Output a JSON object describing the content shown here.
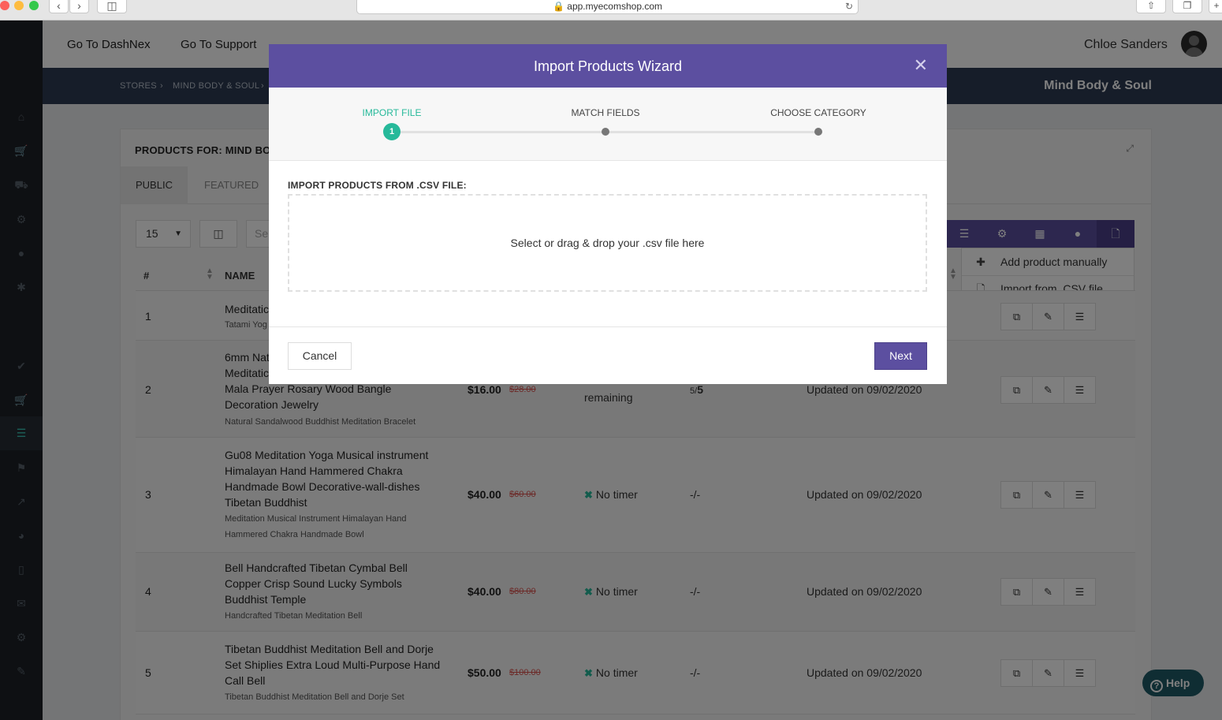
{
  "browser": {
    "url": "app.myecomshop.com"
  },
  "topbar": {
    "links": [
      "Go To DashNex",
      "Go To Support"
    ],
    "user_name": "Chloe Sanders"
  },
  "breadcrumb": {
    "items": [
      "STORES",
      "MIND BODY & SOUL"
    ],
    "store_title": "Mind Body & Soul"
  },
  "panel": {
    "title": "PRODUCTS FOR: MIND BO",
    "tabs": [
      "PUBLIC",
      "FEATURED"
    ],
    "page_size": "15",
    "search_placeholder": "Se"
  },
  "add_menu": {
    "items": [
      {
        "label": "Add product manually",
        "icon": "plus-icon"
      },
      {
        "label": "Import from .CSV file",
        "icon": "csv-file-icon"
      }
    ]
  },
  "table": {
    "columns": [
      "#",
      "NAME"
    ],
    "rows": [
      {
        "num": "1",
        "name_lines": [
          "Meditatic"
        ],
        "sub_lines": [
          "Tatami Yog"
        ],
        "price": "",
        "old_price": "",
        "timer": "",
        "stock_a": "",
        "stock_b": "",
        "updated": ""
      },
      {
        "num": "2",
        "name_lines": [
          "6mm Nat",
          "Meditatic",
          "Mala Prayer Rosary Wood Bangle",
          "Decoration Jewelry"
        ],
        "sub_lines": [
          "Natural Sandalwood Buddhist Meditation Bracelet"
        ],
        "price": "$16.00",
        "old_price": "$28.00",
        "timer": "remaining",
        "stock_a": "5/",
        "stock_b": "5",
        "updated": "Updated on 09/02/2020"
      },
      {
        "num": "3",
        "name_lines": [
          "Gu08 Meditation Yoga Musical instrument",
          "Himalayan Hand Hammered Chakra",
          "Handmade Bowl Decorative-wall-dishes",
          "Tibetan Buddhist"
        ],
        "sub_lines": [
          "Meditation Musical Instrument Himalayan Hand",
          "Hammered Chakra Handmade Bowl"
        ],
        "price": "$40.00",
        "old_price": "$60.00",
        "timer": "No timer",
        "stock_a": "-/-",
        "stock_b": "",
        "updated": "Updated on 09/02/2020"
      },
      {
        "num": "4",
        "name_lines": [
          "Bell Handcrafted Tibetan Cymbal Bell",
          "Copper Crisp Sound Lucky Symbols",
          "Buddhist Temple"
        ],
        "sub_lines": [
          "Handcrafted Tibetan Meditation Bell"
        ],
        "price": "$40.00",
        "old_price": "$80.00",
        "timer": "No timer",
        "stock_a": "-/-",
        "stock_b": "",
        "updated": "Updated on 09/02/2020"
      },
      {
        "num": "5",
        "name_lines": [
          "Tibetan Buddhist Meditation Bell and Dorje",
          "Set Shiplies Extra Loud Multi-Purpose Hand",
          "Call Bell"
        ],
        "sub_lines": [
          "Tibetan Buddhist Meditation Bell and Dorje Set"
        ],
        "price": "$50.00",
        "old_price": "$100.00",
        "timer": "No timer",
        "stock_a": "-/-",
        "stock_b": "",
        "updated": "Updated on 09/02/2020"
      }
    ]
  },
  "help": {
    "label": "Help"
  },
  "modal": {
    "title": "Import Products Wizard",
    "steps": [
      {
        "label": "IMPORT FILE",
        "number": "1",
        "active": true
      },
      {
        "label": "MATCH FIELDS",
        "active": false
      },
      {
        "label": "CHOOSE CATEGORY",
        "active": false
      }
    ],
    "import_label": "IMPORT PRODUCTS FROM .CSV FILE:",
    "dropzone_text": "Select or drag & drop your .csv file here",
    "cancel_label": "Cancel",
    "next_label": "Next"
  },
  "colors": {
    "modal_header": "#5c4fa0",
    "accent_teal": "#26b99a",
    "sidebar": "#1c2126",
    "breadcrumb_bar": "#2c3b52",
    "old_price": "#d9534f"
  }
}
